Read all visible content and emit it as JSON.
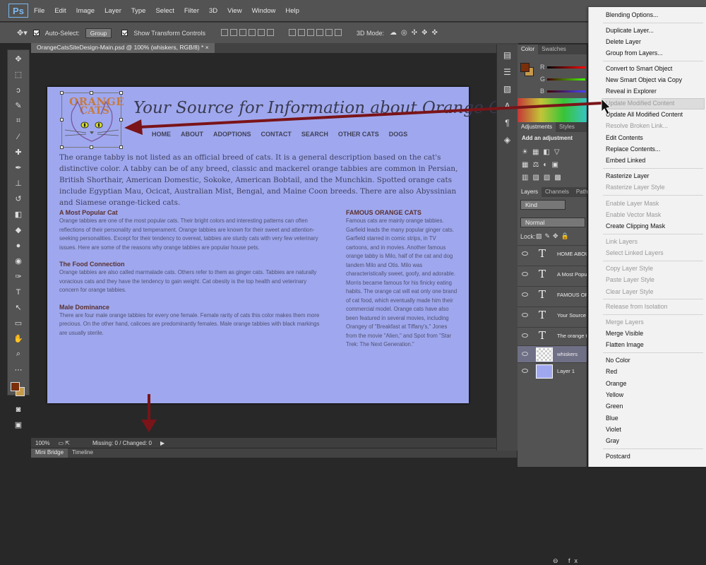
{
  "app": {
    "logo": "Ps",
    "menu": [
      "File",
      "Edit",
      "Image",
      "Layer",
      "Type",
      "Select",
      "Filter",
      "3D",
      "View",
      "Window",
      "Help"
    ]
  },
  "options": {
    "auto_select_label": "Auto-Select:",
    "auto_select_value": "Group",
    "transform_label": "Show Transform Controls",
    "mode_label": "3D Mode:"
  },
  "document": {
    "tab_title": "OrangeCatsSiteDesign-Main.psd @ 100% (whiskers, RGB/8) *",
    "zoom": "100%",
    "status": "Missing: 0 / Changed: 0"
  },
  "bottom_tabs": [
    "Mini Bridge",
    "Timeline"
  ],
  "site": {
    "logo_line1": "ORANGE",
    "logo_line2": "CATS",
    "tagline": "Your Source for Information about Orange Cats",
    "nav": [
      "HOME",
      "ABOUT",
      "ADOPTIONS",
      "CONTACT",
      "SEARCH",
      "OTHER CATS",
      "DOGS"
    ],
    "intro": "The orange tabby is not listed as an official breed of cats. It is a general description based on the cat's distinctive color. A tabby can be of any breed, classic and mackerel orange tabbies are common in Persian, British Shorthair, American Domestic, Sokoke, American Bobtail, and the Munchkin. Spotted orange cats include Egyptian Mau, Ocicat, Australian Mist, Bengal, and Maine Coon breeds. There are also Abyssinian and Siamese orange-ticked cats.",
    "sections": [
      {
        "heading": "A Most Popular Cat",
        "body": "Orange tabbies are one of the most popular cats. Their bright colors and interesting patterns can often reflections of their personality and temperament. Orange tabbies are known for their sweet and attention-seeking personalities. Except for their tendency to overeat, tabbies are sturdy cats with very few veterinary issues. Here are some of the reasons why orange tabbies are popular house pets."
      },
      {
        "heading": "The Food Connection",
        "body": "Orange tabbies are also called marmalade cats. Others refer to them as ginger cats. Tabbies are naturally voracious cats and they have the tendency to gain weight. Cat obesity is the top health and veterinary concern for orange tabbies."
      },
      {
        "heading": "Male Dominance",
        "body": "There are four male orange tabbies for every one female. Female rarity of cats this color makes them more precious. On the other hand, calicoes are predominantly females. Male orange tabbies with black markings are usually sterile."
      }
    ],
    "famous_heading": "FAMOUS ORANGE CATS",
    "famous_body": "Famous cats are mainly orange tabbies. Garfield leads the many popular ginger cats. Garfield starred in comic strips, in TV cartoons, and in movies. Another famous orange tabby is Milo, half of the cat and dog tandem Milo and Otis. Milo was characteristically sweet, goofy, and adorable. Morris became famous for his finicky eating habits. The orange cat will eat only one brand of cat food, which eventually made him their commercial model. Orange cats have also been featured in several movies, including Orangey of \"Breakfast at Tiffany's,\" Jones from the movie \"Alien,\" and Spot from \"Star Trek: The Next Generation.\""
  },
  "panels": {
    "color_tabs": [
      "Color",
      "Swatches"
    ],
    "rgb": [
      "R",
      "G",
      "B"
    ],
    "adj_tabs": [
      "Adjustments",
      "Styles"
    ],
    "add_adjustment": "Add an adjustment",
    "layer_tabs": [
      "Layers",
      "Channels",
      "Paths"
    ],
    "kind": "Kind",
    "blend": "Normal",
    "lock": "Lock:",
    "layers": [
      {
        "type": "text",
        "name": "HOME ABOUT"
      },
      {
        "type": "text",
        "name": "A Most Popular"
      },
      {
        "type": "text",
        "name": "FAMOUS ORANGE"
      },
      {
        "type": "text",
        "name": "Your Source"
      },
      {
        "type": "text",
        "name": "The orange tabby"
      },
      {
        "type": "image",
        "name": "whiskers"
      },
      {
        "type": "fill",
        "name": "Layer 1"
      }
    ]
  },
  "context_menu": [
    {
      "label": "Blending Options...",
      "disabled": false
    },
    {
      "label": "Duplicate Layer...",
      "disabled": false
    },
    {
      "label": "Delete Layer",
      "disabled": false
    },
    {
      "label": "Group from Layers...",
      "disabled": false
    },
    {
      "label": "Convert to Smart Object",
      "disabled": false
    },
    {
      "label": "New Smart Object via Copy",
      "disabled": false
    },
    {
      "label": "Reveal in Explorer",
      "disabled": false
    },
    {
      "label": "Update Modified Content",
      "disabled": true
    },
    {
      "label": "Update All Modified Content",
      "disabled": false
    },
    {
      "label": "Resolve Broken Link...",
      "disabled": true
    },
    {
      "label": "Edit Contents",
      "disabled": false
    },
    {
      "label": "Replace Contents...",
      "disabled": false
    },
    {
      "label": "Embed Linked",
      "disabled": false
    },
    {
      "label": "Rasterize Layer",
      "disabled": false
    },
    {
      "label": "Rasterize Layer Style",
      "disabled": true
    },
    {
      "label": "Enable Layer Mask",
      "disabled": true
    },
    {
      "label": "Enable Vector Mask",
      "disabled": true
    },
    {
      "label": "Create Clipping Mask",
      "disabled": false
    },
    {
      "label": "Link Layers",
      "disabled": true
    },
    {
      "label": "Select Linked Layers",
      "disabled": true
    },
    {
      "label": "Copy Layer Style",
      "disabled": true
    },
    {
      "label": "Paste Layer Style",
      "disabled": true
    },
    {
      "label": "Clear Layer Style",
      "disabled": true
    },
    {
      "label": "Release from Isolation",
      "disabled": true
    },
    {
      "label": "Merge Layers",
      "disabled": true
    },
    {
      "label": "Merge Visible",
      "disabled": false
    },
    {
      "label": "Flatten Image",
      "disabled": false
    },
    {
      "label": "No Color",
      "disabled": false
    },
    {
      "label": "Red",
      "disabled": false
    },
    {
      "label": "Orange",
      "disabled": false
    },
    {
      "label": "Yellow",
      "disabled": false
    },
    {
      "label": "Green",
      "disabled": false
    },
    {
      "label": "Blue",
      "disabled": false
    },
    {
      "label": "Violet",
      "disabled": false
    },
    {
      "label": "Gray",
      "disabled": false
    },
    {
      "label": "Postcard",
      "disabled": false
    }
  ],
  "colors": {
    "foreground": "#7a2e0a",
    "background": "#c79a4a",
    "canvas": "#9fa8ee",
    "arrow": "#7a1418"
  }
}
